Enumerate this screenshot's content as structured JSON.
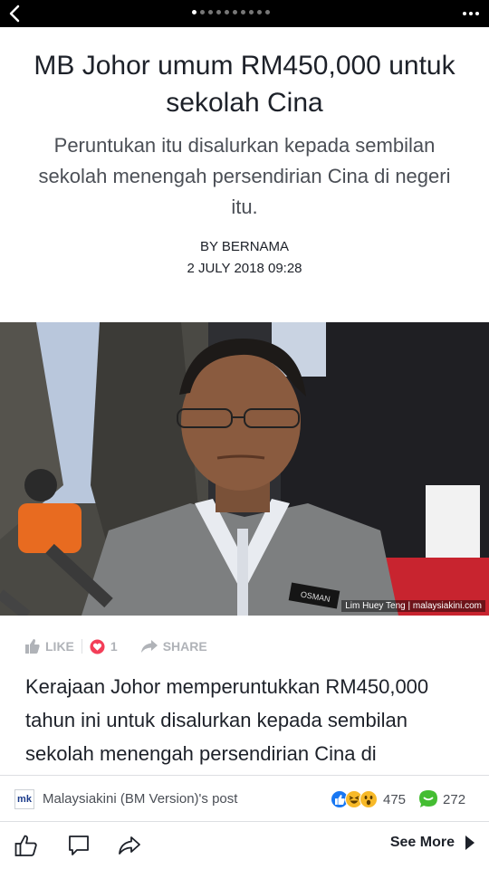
{
  "topbar": {
    "back_icon": "chevron-left-icon",
    "page_dots": 10,
    "active_dot": 0,
    "more_icon": "more-horizontal-icon"
  },
  "article": {
    "headline": "MB Johor umum RM450,000 untuk sekolah Cina",
    "subtitle": "Peruntukan itu disalurkan kepada sembilan sekolah menengah persendirian Cina di negeri itu.",
    "byline": "BY BERNAMA",
    "date": "2 JULY 2018 09:28",
    "photo_credit": "Lim Huey Teng | malaysiakini.com",
    "body": "Kerajaan Johor memperuntukkan RM450,000 tahun ini untuk disalurkan kepada sembilan sekolah menengah persendirian Cina di"
  },
  "actions": {
    "like_label": "LIKE",
    "love_count": "1",
    "share_label": "SHARE"
  },
  "post": {
    "logo_text": "mk",
    "source": "Malaysiakini (BM Version)'s post",
    "reaction_count": "475",
    "comment_count": "272"
  },
  "bottombar": {
    "see_more_label": "See More"
  },
  "colors": {
    "facebook_blue": "#1877f2",
    "love_red": "#f33e58",
    "comment_green": "#44bd32",
    "muted_gray": "#b0b3b8"
  }
}
